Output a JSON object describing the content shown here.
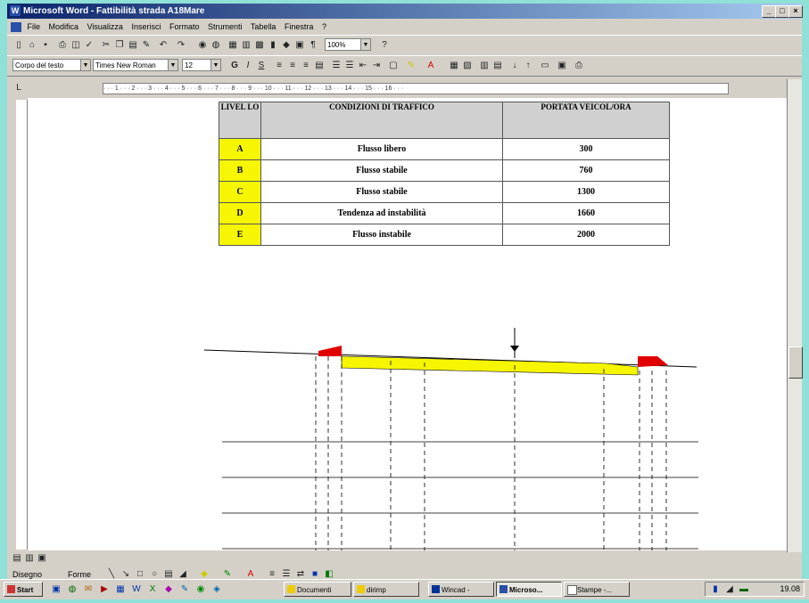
{
  "window": {
    "title": "Microsoft Word - Fattibilità strada A18Mare"
  },
  "menu": [
    "File",
    "Modifica",
    "Visualizza",
    "Inserisci",
    "Formato",
    "Strumenti",
    "Tabella",
    "Finestra",
    "?"
  ],
  "toolbar": {
    "zoom": "100%",
    "style": "Corpo del testo",
    "font": "Times New Roman",
    "size": "12"
  },
  "table": {
    "headers": [
      "LIVEL LO",
      "CONDIZIONI DI TRAFFICO",
      "PORTATA VEICOL/ORA"
    ],
    "rows": [
      {
        "level": "A",
        "condition": "Flusso libero",
        "flow": "300"
      },
      {
        "level": "B",
        "condition": "Flusso stabile",
        "flow": "760"
      },
      {
        "level": "C",
        "condition": "Flusso stabile",
        "flow": "1300"
      },
      {
        "level": "D",
        "condition": "Tendenza ad instabilità",
        "flow": "1660"
      },
      {
        "level": "E",
        "condition": "Flusso instabile",
        "flow": "2000"
      }
    ]
  },
  "drawing_toolbar": {
    "draw": "Disegno",
    "shapes": "Forme"
  },
  "taskbar": {
    "start": "Start",
    "items": [
      "Documenti",
      "dirimp",
      "Wincad -",
      "Microso...",
      "Stampe -..."
    ],
    "clock": "19.08"
  },
  "colors": {
    "title_start": "#0a246a",
    "title_end": "#a6caf0",
    "highlight": "#f6f600",
    "red": "#e00000"
  }
}
